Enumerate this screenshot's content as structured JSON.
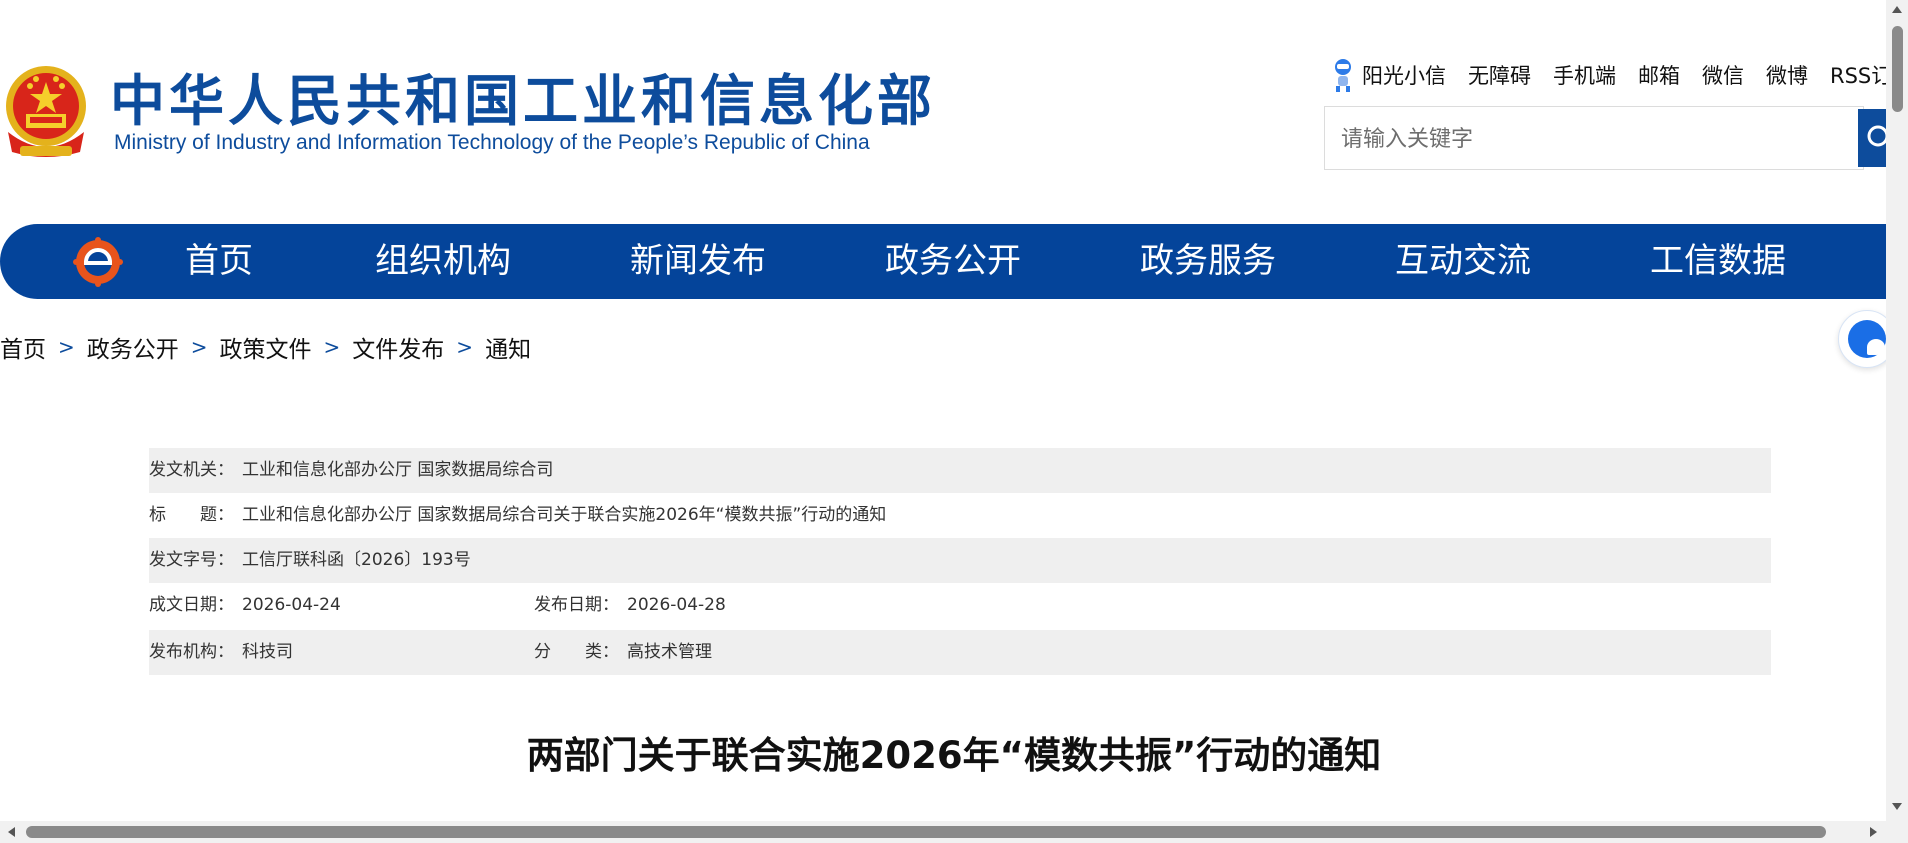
{
  "header": {
    "title_cn": "中华人民共和国工业和信息化部",
    "title_en": "Ministry of Industry and Information Technology of the People’s Republic of China",
    "top_links": [
      "阳光小信",
      "无障碍",
      "手机端",
      "邮箱",
      "微信",
      "微博",
      "RSS订"
    ],
    "search_placeholder": "请输入关键字"
  },
  "nav": {
    "items": [
      "首页",
      "组织机构",
      "新闻发布",
      "政务公开",
      "政务服务",
      "互动交流",
      "工信数据"
    ]
  },
  "breadcrumb": [
    "首页",
    "政务公开",
    "政策文件",
    "文件发布",
    "通知"
  ],
  "breadcrumb_sep": ">",
  "info": {
    "issuer_label": "发文机关：",
    "issuer": "工业和信息化部办公厅 国家数据局综合司",
    "title_label": "标　　题：",
    "title": "工业和信息化部办公厅 国家数据局综合司关于联合实施2026年“模数共振”行动的通知",
    "docno_label": "发文字号：",
    "docno": "工信厅联科函〔2026〕193号",
    "written_label": "成文日期：",
    "written": "2026-04-24",
    "published_label": "发布日期：",
    "published": "2026-04-28",
    "org_label": "发布机构：",
    "org": "科技司",
    "category_label": "分　　类：",
    "category": "高技术管理"
  },
  "doc_title": "两部门关于联合实施2026年“模数共振”行动的通知",
  "colors": {
    "brand_blue": "#04449a",
    "row_gray": "#efefef"
  },
  "icons": [
    "national-emblem-icon",
    "robot-icon",
    "search-icon",
    "miit-logo-icon",
    "chat-bubble-icon"
  ]
}
